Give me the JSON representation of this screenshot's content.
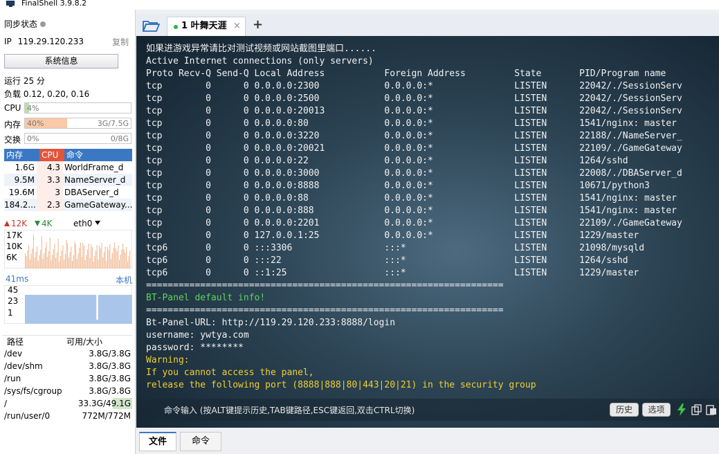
{
  "window": {
    "title": "FinalShell 3.9.8.2"
  },
  "sidebar": {
    "sync_label": "同步状态",
    "ip_label": "IP",
    "ip": "119.29.120.233",
    "copy_label": "复制",
    "sysinfo_button": "系统信息",
    "uptime": "运行 25 分",
    "load": "负载 0.12, 0.20, 0.16",
    "cpu": {
      "label": "CPU",
      "text": "4%",
      "percent": 4,
      "color": "#b8e0b0"
    },
    "mem": {
      "label": "内存",
      "text": "40%",
      "right": "3G/7.5G",
      "percent": 40,
      "color": "#f9c9a8"
    },
    "swap": {
      "label": "交换",
      "text": "0%",
      "right": "0/8G",
      "percent": 0,
      "color": "#b8e0b0"
    },
    "proc_headers": {
      "mem": "内存",
      "cpu": "CPU",
      "cmd": "命令"
    },
    "processes": [
      {
        "mem": "1.6G",
        "cpu": "4.3",
        "cmd": "WorldFrame_d"
      },
      {
        "mem": "9.5M",
        "cpu": "3.3",
        "cmd": "NameServer_d"
      },
      {
        "mem": "19.6M",
        "cpu": "3",
        "cmd": "DBAServer_d"
      },
      {
        "mem": "184.2...",
        "cpu": "2.3",
        "cmd": "GameGateway..."
      }
    ],
    "net": {
      "up": "12K",
      "down": "4K",
      "iface": "eth0",
      "ticks": [
        "17K",
        "10K",
        "6K"
      ]
    },
    "ping": {
      "latency": "41ms",
      "location": "本机",
      "ticks": [
        "45",
        "23",
        "1"
      ]
    },
    "disk_headers": {
      "path": "路径",
      "size": "可用/大小"
    },
    "disks": [
      {
        "path": "/dev",
        "size": "3.8G/3.8G",
        "used": 0
      },
      {
        "path": "/dev/shm",
        "size": "3.8G/3.8G",
        "used": 0
      },
      {
        "path": "/run",
        "size": "3.8G/3.8G",
        "used": 0
      },
      {
        "path": "/sys/fs/cgroup",
        "size": "3.8G/3.8G",
        "used": 0
      },
      {
        "path": "/",
        "size": "33.3G/49.1G",
        "used": 32
      },
      {
        "path": "/run/user/0",
        "size": "772M/772M",
        "used": 0
      }
    ]
  },
  "tabs": {
    "active_label": "1 叶舞天涯",
    "close": "×",
    "add": "+"
  },
  "terminal": {
    "intro": "如果进游戏异常请比对测试视频或网站截图里端口......",
    "active_header": "Active Internet connections (only servers)",
    "columns": "Proto Recv-Q Send-Q Local Address           Foreign Address         State       PID/Program name",
    "connections": [
      "tcp        0      0 0.0.0.0:2300            0.0.0.0:*               LISTEN      22042/./SessionServ",
      "tcp        0      0 0.0.0.0:2500            0.0.0.0:*               LISTEN      22042/./SessionServ",
      "tcp        0      0 0.0.0.0:20013           0.0.0.0:*               LISTEN      22042/./SessionServ",
      "tcp        0      0 0.0.0.0:80              0.0.0.0:*               LISTEN      1541/nginx: master",
      "tcp        0      0 0.0.0.0:3220            0.0.0.0:*               LISTEN      22188/./NameServer_",
      "tcp        0      0 0.0.0.0:20021           0.0.0.0:*               LISTEN      22109/./GameGateway",
      "tcp        0      0 0.0.0.0:22              0.0.0.0:*               LISTEN      1264/sshd",
      "tcp        0      0 0.0.0.0:3000            0.0.0.0:*               LISTEN      22008/./DBAServer_d",
      "tcp        0      0 0.0.0.0:8888            0.0.0.0:*               LISTEN      10671/python3",
      "tcp        0      0 0.0.0.0:88              0.0.0.0:*               LISTEN      1541/nginx: master",
      "tcp        0      0 0.0.0.0:888             0.0.0.0:*               LISTEN      1541/nginx: master",
      "tcp        0      0 0.0.0.0:2201            0.0.0.0:*               LISTEN      22109/./GameGateway",
      "tcp        0      0 127.0.0.1:25            0.0.0.0:*               LISTEN      1229/master",
      "tcp6       0      0 :::3306                 :::*                    LISTEN      21098/mysqld",
      "tcp6       0      0 :::22                   :::*                    LISTEN      1264/sshd",
      "tcp6       0      0 ::1:25                  :::*                    LISTEN      1229/master"
    ],
    "separator": "==================================================================",
    "bt_header": "BT-Panel default info!",
    "url_line": "Bt-Panel-URL: http://119.29.120.233:8888/login",
    "username_line": "username: ywtya.com",
    "password_line": "password: ********",
    "warning": "Warning:",
    "warn1": "If you cannot access the panel,",
    "warn2": "release the following port (8888|888|80|443|20|21) in the security group"
  },
  "cmdbar": {
    "placeholder": "命令输入 (按ALT键提示历史,TAB键路径,ESC键返回,双击CTRL切换)",
    "history": "历史",
    "options": "选项"
  },
  "bottom_tabs": {
    "files": "文件",
    "commands": "命令"
  },
  "colors": {
    "accent": "#3b78c4",
    "cpu_header": "#e2553b",
    "green": "#5fd35f",
    "yellow": "#f0d030"
  }
}
